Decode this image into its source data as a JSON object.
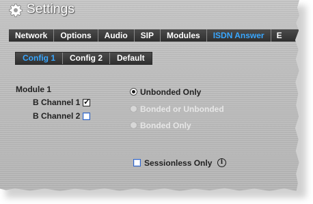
{
  "window": {
    "title": "Settings",
    "icon": "gear-icon"
  },
  "main_tabs": [
    {
      "label": "Network",
      "active": false
    },
    {
      "label": "Options",
      "active": false
    },
    {
      "label": "Audio",
      "active": false
    },
    {
      "label": "SIP",
      "active": false
    },
    {
      "label": "Modules",
      "active": false
    },
    {
      "label": "ISDN Answer",
      "active": true
    },
    {
      "label": "E",
      "active": false
    }
  ],
  "sub_tabs": [
    {
      "label": "Config 1",
      "active": true
    },
    {
      "label": "Config 2",
      "active": false
    },
    {
      "label": "Default",
      "active": false
    }
  ],
  "module": {
    "title": "Module 1",
    "channels": [
      {
        "label": "B Channel 1",
        "checked": true
      },
      {
        "label": "B Channel 2",
        "checked": false
      }
    ]
  },
  "bonding_options": [
    {
      "label": "Unbonded Only",
      "selected": true,
      "enabled": true
    },
    {
      "label": "Bonded or Unbonded",
      "selected": false,
      "enabled": false
    },
    {
      "label": "Bonded Only",
      "selected": false,
      "enabled": false
    }
  ],
  "sessionless": {
    "label": "Sessionless Only",
    "checked": false,
    "info_icon": "info-icon"
  },
  "colors": {
    "active_tab": "#39a7ff",
    "tab_bar": "#3a3a3a",
    "disabled_text": "#e6e6e6"
  }
}
